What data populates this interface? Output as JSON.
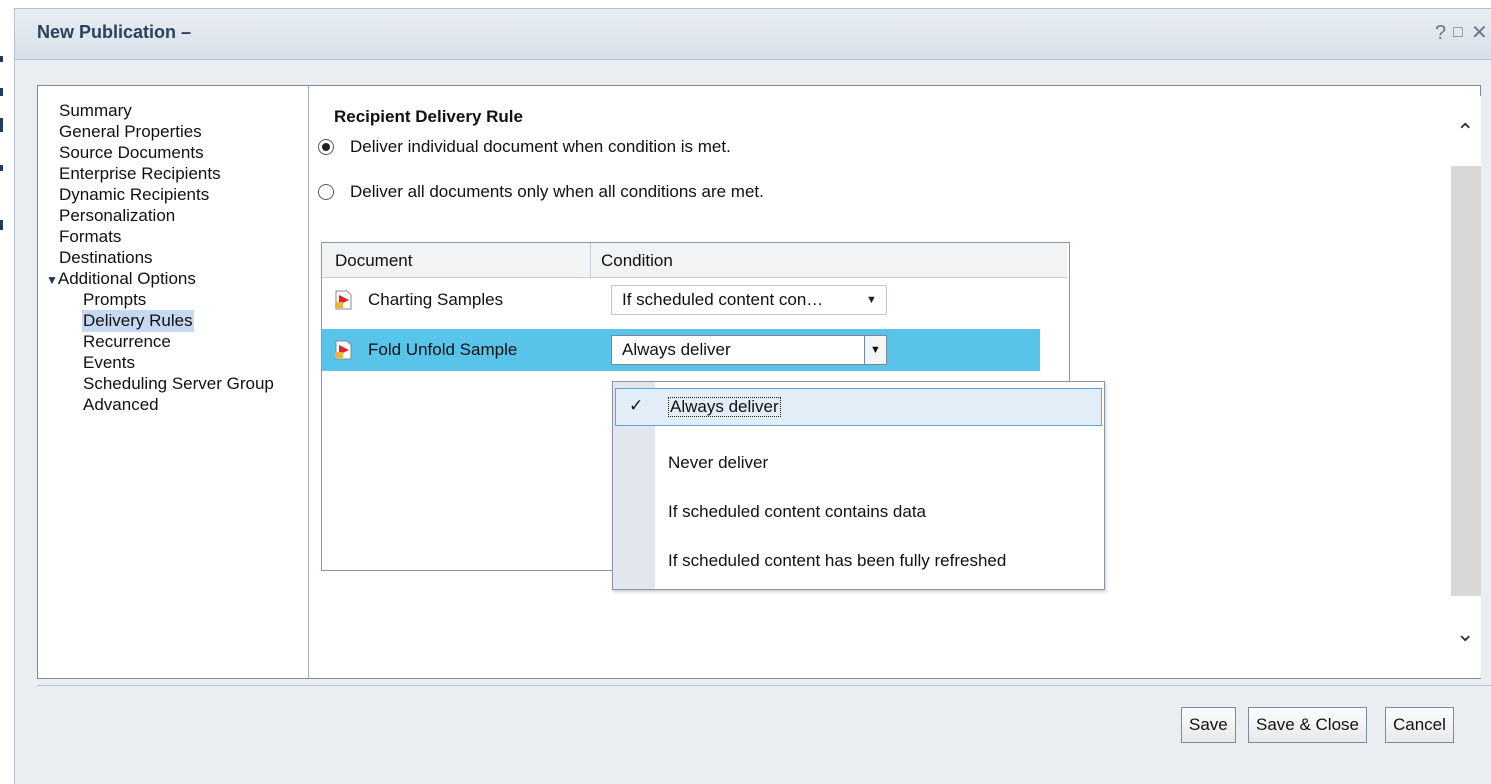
{
  "window": {
    "title": "New Publication –",
    "help_label": "?",
    "maximize_label": "□",
    "close_label": "✕"
  },
  "nav": {
    "items": [
      {
        "label": "Summary"
      },
      {
        "label": "General Properties"
      },
      {
        "label": "Source Documents"
      },
      {
        "label": "Enterprise Recipients"
      },
      {
        "label": "Dynamic Recipients"
      },
      {
        "label": "Personalization"
      },
      {
        "label": "Formats"
      },
      {
        "label": "Destinations"
      },
      {
        "label": "Additional Options",
        "expanded": true
      },
      {
        "label": "Prompts"
      },
      {
        "label": "Delivery Rules",
        "selected": true
      },
      {
        "label": "Recurrence"
      },
      {
        "label": "Events"
      },
      {
        "label": "Scheduling Server Group"
      },
      {
        "label": "Advanced"
      }
    ],
    "expand_glyph": "▼"
  },
  "rule": {
    "heading": "Recipient Delivery Rule",
    "options": [
      {
        "label": "Deliver individual document when condition is met.",
        "selected": true
      },
      {
        "label": "Deliver all documents only when all conditions are met.",
        "selected": false
      }
    ]
  },
  "table": {
    "columns": [
      "Document",
      "Condition"
    ],
    "rows": [
      {
        "document": "Charting Samples",
        "condition": "If scheduled content con…",
        "selected": false
      },
      {
        "document": "Fold Unfold Sample",
        "condition": "Always deliver",
        "selected": true
      }
    ],
    "dropdown_glyph": "▼"
  },
  "condition_menu": {
    "options": [
      "Always deliver",
      "Never deliver",
      "If scheduled content contains data",
      "If scheduled content has been fully refreshed"
    ],
    "checked_index": 0,
    "check_glyph": "✓"
  },
  "scroll": {
    "up_glyph": "⌃",
    "down_glyph": "⌄"
  },
  "buttons": {
    "save": "Save",
    "save_close": "Save & Close",
    "cancel": "Cancel"
  },
  "colors": {
    "selected_row": "#58c4ea",
    "nav_selected": "#c7d8f2",
    "title_text": "#2b4160"
  }
}
